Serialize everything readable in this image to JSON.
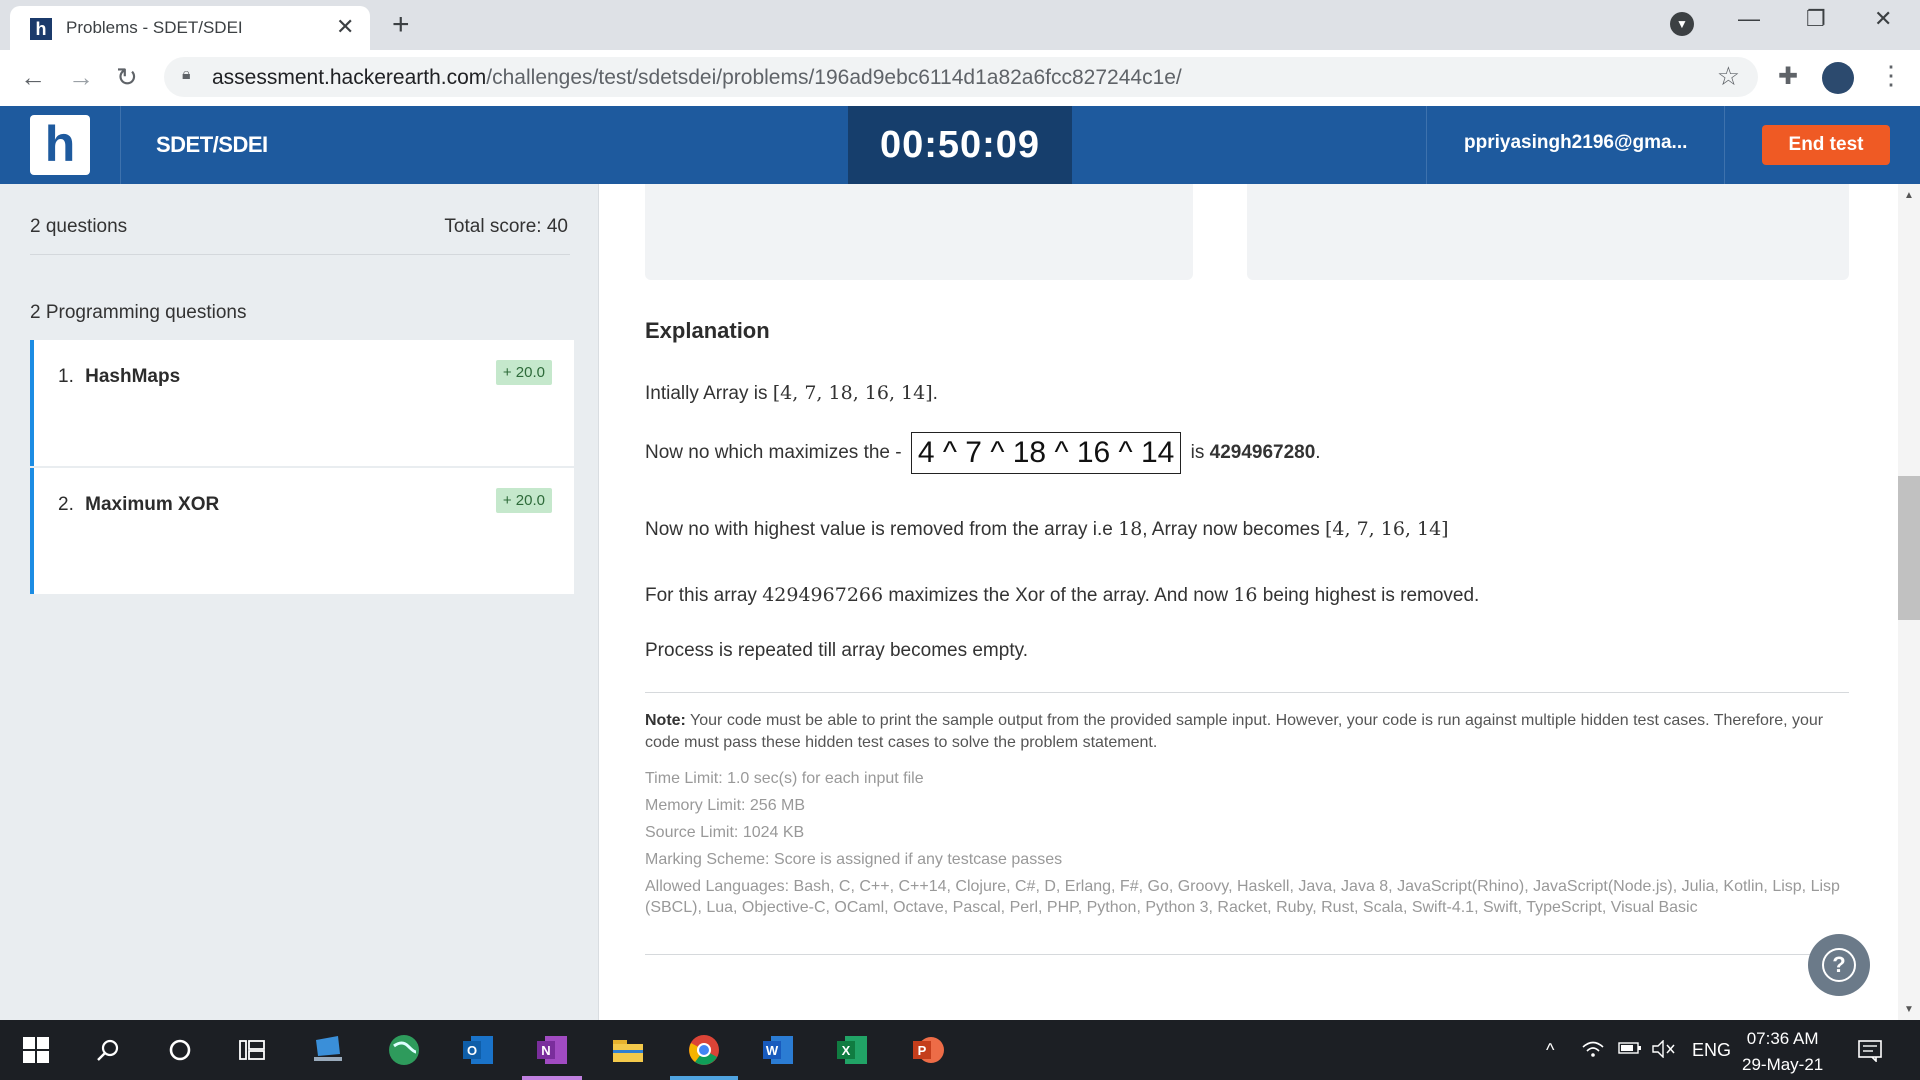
{
  "browser": {
    "tab_title": "Problems - SDET/SDEI",
    "tab_favicon": "h",
    "url_host": "assessment.hackerearth.com",
    "url_path": "/challenges/test/sdetsdei/problems/196ad9ebc6114d1a82a6fcc827244c1e/"
  },
  "header": {
    "logo": "h",
    "test_name": "SDET/SDEI",
    "timer": "00:50:09",
    "user_email": "ppriyasingh2196@gma...",
    "end_test_label": "End test"
  },
  "sidebar": {
    "question_count": "2 questions",
    "total_score": "Total score: 40",
    "section_title": "2 Programming questions",
    "questions": [
      {
        "num": "1.",
        "title": "HashMaps",
        "score": "+ 20.0"
      },
      {
        "num": "2.",
        "title": "Maximum XOR",
        "score": "+ 20.0"
      }
    ]
  },
  "problem": {
    "explanation_heading": "Explanation",
    "line1_text": "Intially Array is ",
    "line1_array": "[4, 7, 18, 16, 14]",
    "line1_end": ".",
    "line2_text": "Now no which maximizes the - ",
    "line2_expr": "4 ^ 7 ^ 18 ^ 16 ^ 14",
    "line2_mid": " is ",
    "line2_value": "4294967280",
    "line2_end": ".",
    "line3_text": "Now no with highest value is removed from the array i.e ",
    "line3_num": "18",
    "line3_mid": ", Array now becomes ",
    "line3_array": "[4, 7, 16, 14]",
    "line4_text": "For this array ",
    "line4_num": "4294967266",
    "line4_mid": " maximizes the Xor of the array. And now ",
    "line4_num2": "16",
    "line4_end": " being highest is removed.",
    "line5_text": "Process is repeated till array becomes empty.",
    "note_label": "Note:",
    "note_text": " Your code must be able to print the sample output from the provided sample input. However, your code is run against multiple hidden test cases. Therefore, your code must pass these hidden test cases to solve the problem statement.",
    "time_limit": "Time Limit: 1.0 sec(s) for each input file",
    "memory_limit": "Memory Limit: 256 MB",
    "source_limit": "Source Limit: 1024 KB",
    "marking_scheme": "Marking Scheme: Score is assigned if any testcase passes",
    "allowed_languages": "Allowed Languages: Bash, C, C++, C++14, Clojure, C#, D, Erlang, F#, Go, Groovy, Haskell, Java, Java 8, JavaScript(Rhino), JavaScript(Node.js), Julia, Kotlin, Lisp, Lisp (SBCL), Lua, Objective-C, OCaml, Octave, Pascal, Perl, PHP, Python, Python 3, Racket, Ruby, Rust, Scala, Swift-4.1, Swift, TypeScript, Visual Basic"
  },
  "help_glyph": "?",
  "taskbar": {
    "language": "ENG",
    "time": "07:36 AM",
    "date": "29-May-21"
  },
  "colors": {
    "brand_blue": "#1e5a9e",
    "timer_bg": "#163e6c",
    "end_test": "#ef5a24",
    "accent_bar": "#1c8ce3",
    "score_badge": "#c5e8cc"
  }
}
